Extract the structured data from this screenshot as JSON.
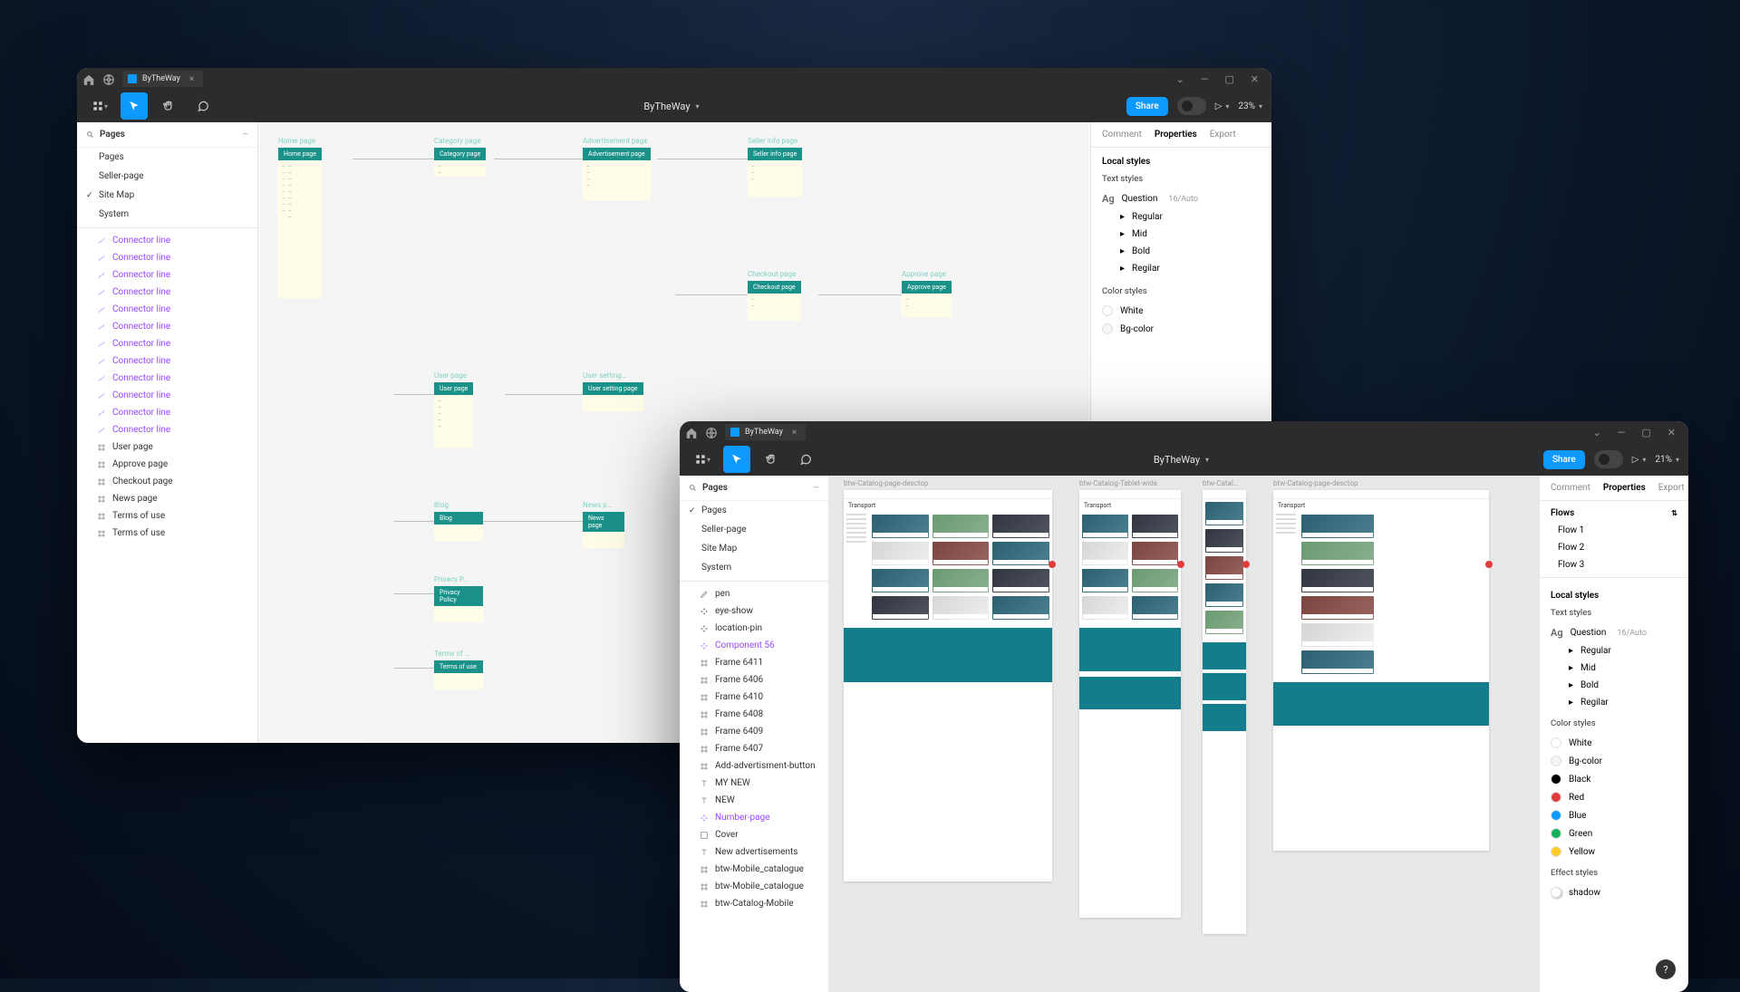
{
  "window1": {
    "tab_title": "ByTheWay",
    "doc_title": "ByTheWay",
    "share_label": "Share",
    "zoom": "23%",
    "sidebar": {
      "section_title": "Pages",
      "pages": [
        "Pages",
        "Seller-page",
        "Site Map",
        "System"
      ],
      "selected_page_index": 2,
      "connector_label": "Connector line",
      "connector_count": 12,
      "layers": [
        "User page",
        "Approve page",
        "Checkout page",
        "News page",
        "Terms of use",
        "Terms of use"
      ]
    },
    "canvas_frames": {
      "home": "Home page",
      "category": "Category page",
      "ad": "Advertisement page",
      "seller": "Seller info page",
      "checkout": "Checkout page",
      "approve": "Approve page",
      "user": "User page",
      "settings": "User setting…",
      "blog": "Blog",
      "news": "News p…",
      "privacy": "Privacy P…",
      "privacy_tag": "Privacy Policy",
      "terms": "Terms of …",
      "terms_tag": "Terms of use"
    },
    "right": {
      "tabs": [
        "Comment",
        "Properties",
        "Export"
      ],
      "local_styles": "Local styles",
      "text_styles": "Text styles",
      "question": "Question",
      "question_meta": "16/Auto",
      "text_items": [
        "Regular",
        "Mid",
        "Bold",
        "Regilar"
      ],
      "color_styles": "Color styles",
      "color_items": [
        {
          "name": "White",
          "hex": "#ffffff"
        },
        {
          "name": "Bg-color",
          "hex": "#f5f5f5"
        }
      ]
    }
  },
  "window2": {
    "tab_title": "ByTheWay",
    "doc_title": "ByTheWay",
    "share_label": "Share",
    "zoom": "21%",
    "sidebar": {
      "section_title": "Pages",
      "pages": [
        "Pages",
        "Seller-page",
        "Site Map",
        "System"
      ],
      "selected_page_index": 0,
      "layers": [
        {
          "icon": "edit",
          "label": "pen"
        },
        {
          "icon": "comp",
          "label": "eye-show"
        },
        {
          "icon": "comp",
          "label": "location-pin"
        },
        {
          "icon": "comp",
          "label": "Component 56",
          "purple": true
        },
        {
          "icon": "frame",
          "label": "Frame 6411"
        },
        {
          "icon": "frame",
          "label": "Frame 6406"
        },
        {
          "icon": "frame",
          "label": "Frame 6410"
        },
        {
          "icon": "frame",
          "label": "Frame 6408"
        },
        {
          "icon": "frame",
          "label": "Frame 6409"
        },
        {
          "icon": "frame",
          "label": "Frame 6407"
        },
        {
          "icon": "frame",
          "label": "Add-advertisment-button"
        },
        {
          "icon": "text",
          "label": "MY NEW"
        },
        {
          "icon": "text",
          "label": "NEW"
        },
        {
          "icon": "comp",
          "label": "Number-page",
          "purple": true
        },
        {
          "icon": "group",
          "label": "Cover"
        },
        {
          "icon": "text",
          "label": "New advertisements"
        },
        {
          "icon": "frame",
          "label": "btw-Mobile_catalogue"
        },
        {
          "icon": "frame",
          "label": "btw-Mobile_catalogue"
        },
        {
          "icon": "frame",
          "label": "btw-Catalog-Mobile"
        }
      ]
    },
    "canvas_labels": [
      "btw-Catalog-page-desctop",
      "btw-Catalog-Tablet-wide",
      "btw-Catal…",
      "btw-Catalog-page-desctop"
    ],
    "frame_heading": "Transport",
    "right": {
      "tabs": [
        "Comment",
        "Properties",
        "Export"
      ],
      "flows_title": "Flows",
      "flows": [
        "Flow 1",
        "Flow 2",
        "Flow 3"
      ],
      "local_styles": "Local styles",
      "text_styles": "Text styles",
      "question": "Question",
      "question_meta": "16/Auto",
      "text_items": [
        "Regular",
        "Mid",
        "Bold",
        "Regilar"
      ],
      "color_styles": "Color styles",
      "color_items": [
        {
          "name": "White",
          "hex": "#ffffff"
        },
        {
          "name": "Bg-color",
          "hex": "#f5f5f5"
        },
        {
          "name": "Black",
          "hex": "#000000"
        },
        {
          "name": "Red",
          "hex": "#e03e3e"
        },
        {
          "name": "Blue",
          "hex": "#0d99ff"
        },
        {
          "name": "Green",
          "hex": "#14ae5c"
        },
        {
          "name": "Yellow",
          "hex": "#ffcd29"
        }
      ],
      "effect_styles": "Effect styles",
      "effect_items": [
        "shadow"
      ]
    }
  }
}
